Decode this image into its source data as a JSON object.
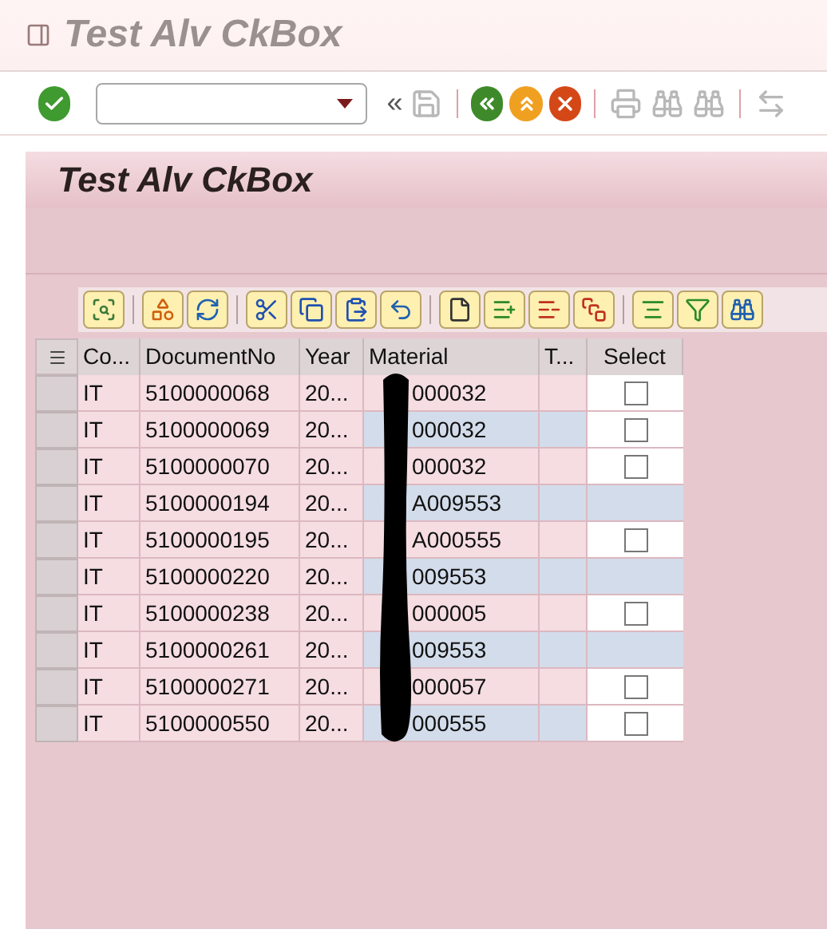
{
  "window": {
    "title": "Test Alv CkBox"
  },
  "toolbar": {
    "expand_glyph": "«"
  },
  "panel": {
    "title": "Test Alv CkBox"
  },
  "table": {
    "columns": [
      "Co...",
      "DocumentNo",
      "Year",
      "Material",
      "T...",
      "Select"
    ],
    "rows": [
      {
        "cells": [
          "IT",
          "5100000068",
          "20...",
          "000032",
          ""
        ],
        "highlighted": false,
        "has_checkbox": true,
        "checked": false
      },
      {
        "cells": [
          "IT",
          "5100000069",
          "20...",
          "000032",
          ""
        ],
        "highlighted": true,
        "has_checkbox": true,
        "checked": false
      },
      {
        "cells": [
          "IT",
          "5100000070",
          "20...",
          "000032",
          ""
        ],
        "highlighted": false,
        "has_checkbox": true,
        "checked": false
      },
      {
        "cells": [
          "IT",
          "5100000194",
          "20...",
          "A009553",
          ""
        ],
        "highlighted": true,
        "has_checkbox": false
      },
      {
        "cells": [
          "IT",
          "5100000195",
          "20...",
          "A000555",
          ""
        ],
        "highlighted": false,
        "has_checkbox": true,
        "checked": false
      },
      {
        "cells": [
          "IT",
          "5100000220",
          "20...",
          "009553",
          ""
        ],
        "highlighted": true,
        "has_checkbox": false
      },
      {
        "cells": [
          "IT",
          "5100000238",
          "20...",
          "000005",
          ""
        ],
        "highlighted": false,
        "has_checkbox": true,
        "checked": false
      },
      {
        "cells": [
          "IT",
          "5100000261",
          "20...",
          "009553",
          ""
        ],
        "highlighted": true,
        "has_checkbox": false
      },
      {
        "cells": [
          "IT",
          "5100000271",
          "20...",
          "000057",
          ""
        ],
        "highlighted": false,
        "has_checkbox": true,
        "checked": false
      },
      {
        "cells": [
          "IT",
          "5100000550",
          "20...",
          "000555",
          ""
        ],
        "highlighted": true,
        "has_checkbox": true,
        "checked": false
      }
    ]
  }
}
